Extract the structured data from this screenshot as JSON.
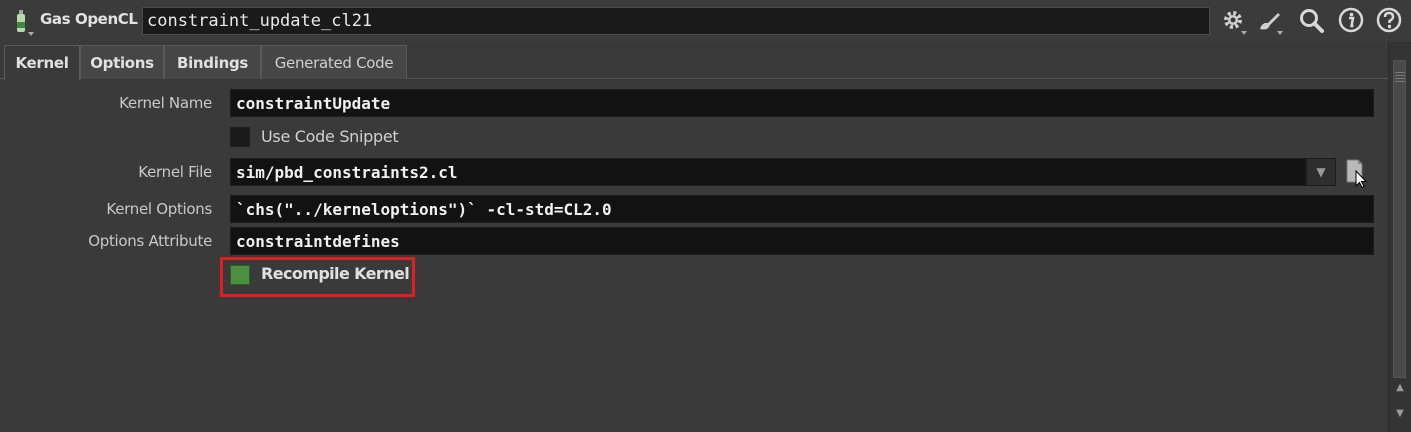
{
  "header": {
    "node_type": "Gas OpenCL",
    "node_name": "constraint_update_cl21",
    "icons": [
      "gear-icon",
      "paint-brush-icon",
      "search-icon",
      "info-icon",
      "help-icon"
    ]
  },
  "tabs": [
    {
      "label": "Kernel",
      "active": true
    },
    {
      "label": "Options",
      "active": false
    },
    {
      "label": "Bindings",
      "active": false
    },
    {
      "label": "Generated Code",
      "active": false
    }
  ],
  "params": {
    "kernel_name": {
      "label": "Kernel Name",
      "value": "constraintUpdate"
    },
    "use_code_snippet": {
      "label": "Use Code Snippet",
      "checked": false
    },
    "kernel_file": {
      "label": "Kernel File",
      "value": "sim/pbd_constraints2.cl"
    },
    "kernel_options": {
      "label": "Kernel Options",
      "value": "`chs(\"../kerneloptions\")` -cl-std=CL2.0"
    },
    "options_attribute": {
      "label": "Options Attribute",
      "value": "constraintdefines"
    },
    "recompile_kernel": {
      "label": "Recompile Kernel",
      "checked": true
    }
  },
  "colors": {
    "background": "#3a3a3a",
    "field_bg": "#121212",
    "checkbox_on": "#4a9040",
    "highlight": "#e02020"
  }
}
